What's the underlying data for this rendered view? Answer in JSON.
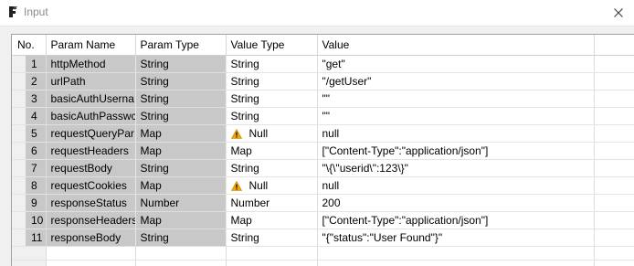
{
  "window": {
    "title": "Input",
    "app_icon": "app-logo-icon",
    "close_icon": "close-icon"
  },
  "table": {
    "headers": [
      "No.",
      "Param Name",
      "Param Type",
      "Value Type",
      "Value"
    ],
    "rows": [
      {
        "no": "1",
        "name": "httpMethod",
        "param_type": "String",
        "value_type": "String",
        "value": "\"get\"",
        "warn": false
      },
      {
        "no": "2",
        "name": "urlPath",
        "param_type": "String",
        "value_type": "String",
        "value": "\"/getUser\"",
        "warn": false
      },
      {
        "no": "3",
        "name": "basicAuthUserna",
        "param_type": "String",
        "value_type": "String",
        "value": "\"\"",
        "warn": false
      },
      {
        "no": "4",
        "name": "basicAuthPasswc",
        "param_type": "String",
        "value_type": "String",
        "value": "\"\"",
        "warn": false
      },
      {
        "no": "5",
        "name": "requestQueryPar",
        "param_type": "Map",
        "value_type": "Null",
        "value": "null",
        "warn": true
      },
      {
        "no": "6",
        "name": "requestHeaders",
        "param_type": "Map",
        "value_type": "Map",
        "value": "[\"Content-Type\":\"application/json\"]",
        "warn": false
      },
      {
        "no": "7",
        "name": "requestBody",
        "param_type": "String",
        "value_type": "String",
        "value": "\"\\{\\\"userid\\\":123\\}\"",
        "warn": false
      },
      {
        "no": "8",
        "name": "requestCookies",
        "param_type": "Map",
        "value_type": "Null",
        "value": "null",
        "warn": true
      },
      {
        "no": "9",
        "name": "responseStatus",
        "param_type": "Number",
        "value_type": "Number",
        "value": "200",
        "warn": false
      },
      {
        "no": "10",
        "name": "responseHeaders",
        "param_type": "Map",
        "value_type": "Map",
        "value": "[\"Content-Type\":\"application/json\"]",
        "warn": false
      },
      {
        "no": "11",
        "name": "responseBody",
        "param_type": "String",
        "value_type": "String",
        "value": "\"{\"status\":\"User Found\"}\"",
        "warn": false
      }
    ]
  },
  "colors": {
    "readonly_cell": "#c8c8c8",
    "warning": "#f0a800"
  }
}
